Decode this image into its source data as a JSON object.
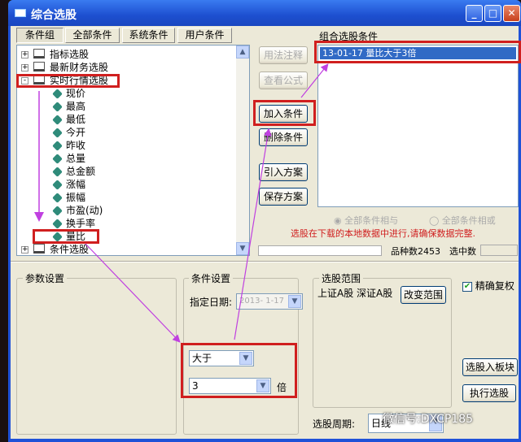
{
  "window": {
    "title": "综合选股",
    "min": "_",
    "max": "□",
    "close": "✕"
  },
  "tabs": [
    {
      "label": "条件组",
      "active": true
    },
    {
      "label": "全部条件"
    },
    {
      "label": "系统条件"
    },
    {
      "label": "用户条件"
    }
  ],
  "tree": {
    "groups": [
      {
        "label": "指标选股",
        "expander": "+"
      },
      {
        "label": "最新财务选股",
        "expander": "+"
      },
      {
        "label": "实时行情选股",
        "expander": "-"
      }
    ],
    "children": [
      "现价",
      "最高",
      "最低",
      "今开",
      "昨收",
      "总量",
      "总金额",
      "涨幅",
      "振幅",
      "市盈(动)",
      "换手率",
      "量比"
    ],
    "last_group": {
      "label": "条件选股",
      "expander": "+"
    }
  },
  "buttons": {
    "usage": "用法注释",
    "formula": "查看公式",
    "add": "加入条件",
    "remove": "删除条件",
    "import": "引入方案",
    "save": "保存方案",
    "change_range": "改变范围",
    "to_block": "选股入板块",
    "execute": "执行选股"
  },
  "combo_list": {
    "label": "组合选股条件",
    "items": [
      "13-01-17 量比大于3倍"
    ]
  },
  "radios": {
    "and": "全部条件相与",
    "or": "全部条件相或"
  },
  "warning": "选股在下载的本地数据中进行,请确保数据完整.",
  "status": {
    "count_label": "品种数",
    "count": "2453",
    "selected_label": "选中数",
    "selected": ""
  },
  "params": {
    "label": "参数设置"
  },
  "condition": {
    "label": "条件设置",
    "date_label": "指定日期:",
    "date": "2013- 1-17",
    "operator": "大于",
    "value": "3",
    "unit": "倍"
  },
  "range": {
    "label": "选股范围",
    "text": "上证A股 深证A股"
  },
  "exact_adjust": {
    "label": "精确复权",
    "checked": true
  },
  "period": {
    "label": "选股周期:",
    "value": "日线"
  },
  "watermark": "微信号:DXCP185",
  "colors": {
    "highlight": "#d01f1f",
    "arrow": "#c040e0",
    "warning": "#d01f1f",
    "selection": "#316ac5"
  }
}
